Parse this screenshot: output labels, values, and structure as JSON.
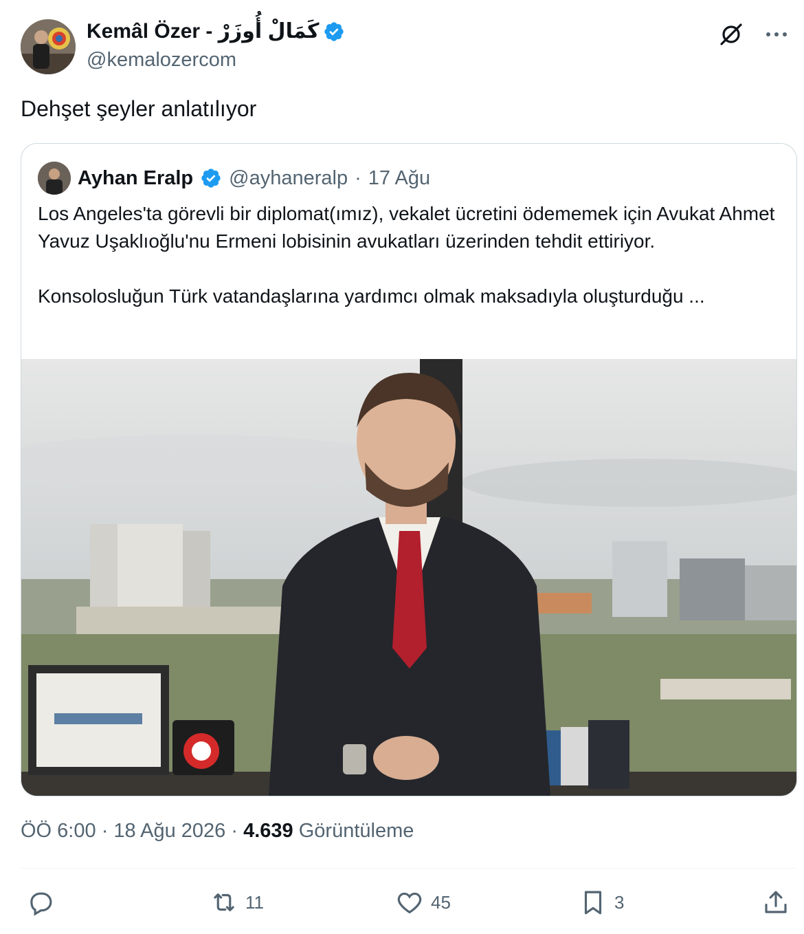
{
  "author": {
    "name": "Kemâl Özer - كَمَالْ أُوزَرْ",
    "handle": "@kemalozercom"
  },
  "icons": {
    "verified": "verified-badge-icon",
    "grok": "grok-icon",
    "more": "more-options-icon"
  },
  "tweet": {
    "text": "Dehşet şeyler anlatılıyor"
  },
  "quote": {
    "name": "Ayhan Eralp",
    "handle": "@ayhaneralp",
    "separator": "·",
    "date": "17 Ağu",
    "paragraph1": "Los Angeles'ta görevli bir  diplomat(ımız), vekalet ücretini ödememek için Avukat Ahmet Yavuz Uşaklıoğlu'nu Ermeni lobisinin avukatları üzerinden tehdit ettiriyor.",
    "paragraph2": "Konsolosluğun Türk vatandaşlarına yardımcı olmak maksadıyla oluşturduğu ..."
  },
  "meta": {
    "time": "ÖÖ 6:00",
    "separator": "·",
    "date": "18 Ağu 2026",
    "views_count": "4.639",
    "views_label": "Görüntüleme"
  },
  "actions": {
    "reply_count": "",
    "retweet_count": "11",
    "like_count": "45",
    "bookmark_count": "3"
  },
  "colors": {
    "verified": "#1d9bf0",
    "text": "#0f1419",
    "secondary": "#536471",
    "border": "#cfd9de"
  }
}
